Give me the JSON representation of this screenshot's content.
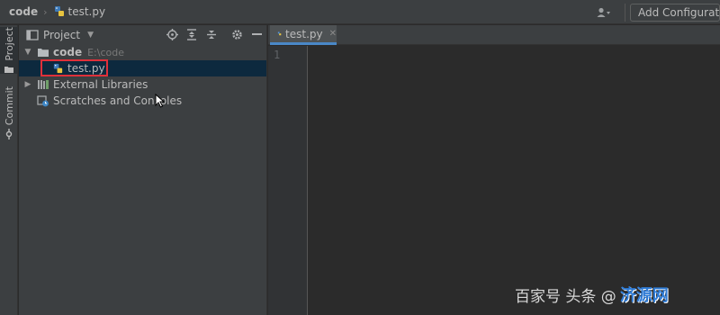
{
  "navbar": {
    "root": "code",
    "file": "test.py",
    "add_config_label": "Add Configuration"
  },
  "stripe": {
    "project_label": "Project",
    "commit_label": "Commit"
  },
  "project_panel": {
    "title": "Project",
    "tree": {
      "root_name": "code",
      "root_path": "E:\\code",
      "file": "test.py",
      "external": "External Libraries",
      "scratches": "Scratches and Consoles"
    }
  },
  "editor": {
    "tab_label": "test.py",
    "line_numbers": [
      "1"
    ]
  },
  "watermark": {
    "text": "百家号 头条 @",
    "logo": "济源网"
  },
  "colors": {
    "accent_tab": "#4a88c7",
    "selection": "#0d293e",
    "highlight_box": "#e0303a"
  }
}
